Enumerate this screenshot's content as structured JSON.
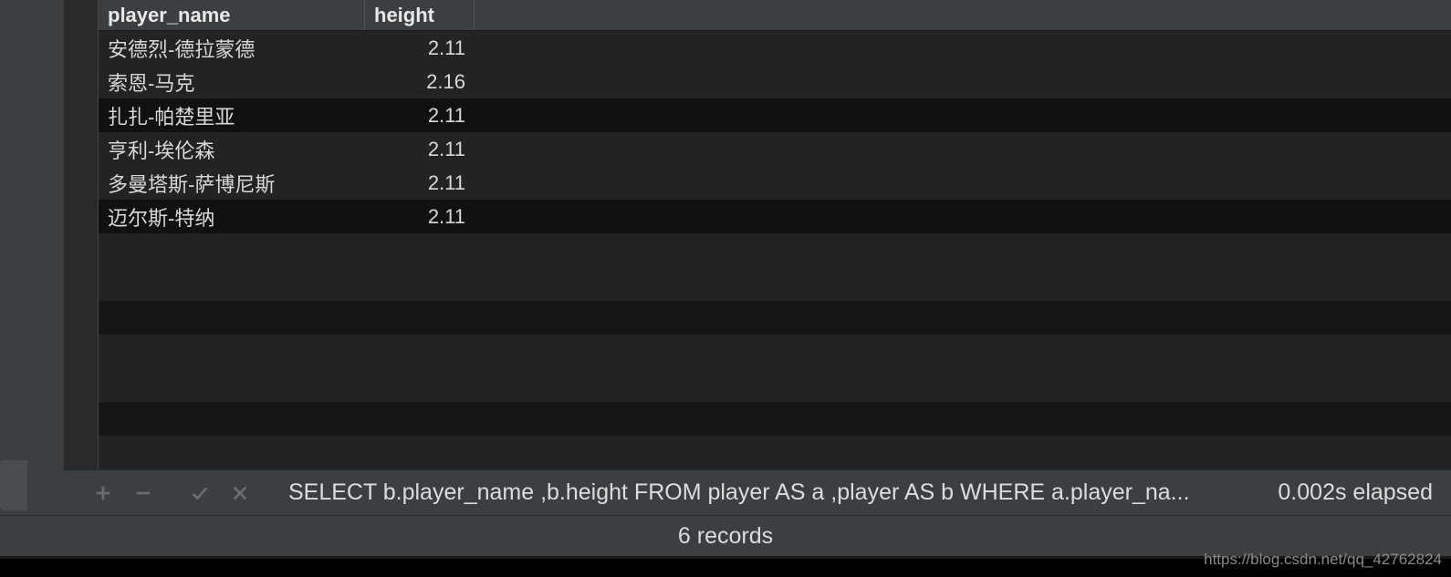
{
  "columns": {
    "name": "player_name",
    "height": "height"
  },
  "rows": [
    {
      "player_name": "安德烈-德拉蒙德",
      "height": "2.11"
    },
    {
      "player_name": "索恩-马克",
      "height": "2.16"
    },
    {
      "player_name": "扎扎-帕楚里亚",
      "height": "2.11"
    },
    {
      "player_name": "亨利-埃伦森",
      "height": "2.11"
    },
    {
      "player_name": "多曼塔斯-萨博尼斯",
      "height": "2.11"
    },
    {
      "player_name": "迈尔斯-特纳",
      "height": "2.11"
    }
  ],
  "toolbar": {
    "sql": "SELECT b.player_name ,b.height FROM player AS a ,player AS b WHERE a.player_na...",
    "elapsed": "0.002s elapsed"
  },
  "status": {
    "records": "6 records"
  },
  "watermark": "https://blog.csdn.net/qq_42762824"
}
